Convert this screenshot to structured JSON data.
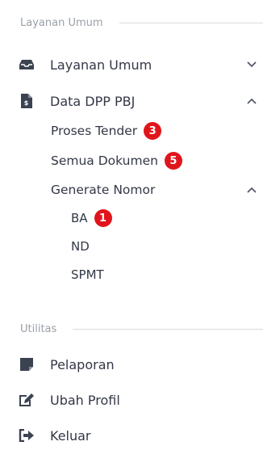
{
  "sections": {
    "layanan_umum": "Layanan Umum",
    "utilitas": "Utilitas"
  },
  "menu": {
    "layanan_umum": {
      "label": "Layanan Umum",
      "icon": "inbox-icon",
      "expanded": false
    },
    "data_dpp_pbj": {
      "label": "Data DPP PBJ",
      "icon": "file-invoice-icon",
      "expanded": true,
      "children": {
        "proses_tender": {
          "label": "Proses Tender",
          "badge": "3"
        },
        "semua_dokumen": {
          "label": "Semua Dokumen",
          "badge": "5"
        },
        "generate_nomor": {
          "label": "Generate Nomor",
          "expanded": true,
          "children": {
            "ba": {
              "label": "BA",
              "badge": "1"
            },
            "nd": {
              "label": "ND"
            },
            "spmt": {
              "label": "SPMT"
            }
          }
        }
      }
    },
    "pelaporan": {
      "label": "Pelaporan",
      "icon": "sticky-note-icon"
    },
    "ubah_profil": {
      "label": "Ubah Profil",
      "icon": "edit-icon"
    },
    "keluar": {
      "label": "Keluar",
      "icon": "sign-out-icon"
    }
  },
  "colors": {
    "badge": "#e0151b",
    "text": "#333846",
    "section": "#9aa0a8"
  }
}
